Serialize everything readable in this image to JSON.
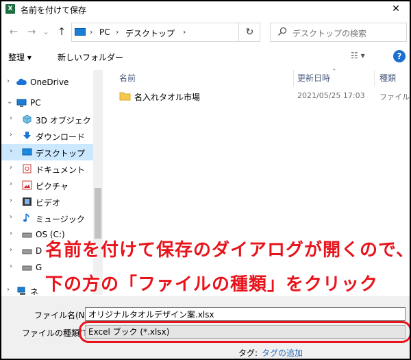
{
  "window": {
    "title": "名前を付けて保存",
    "app_icon_letter": "X",
    "close_glyph": "✕"
  },
  "nav": {
    "back_glyph": "←",
    "forward_glyph": "→",
    "recent_glyph": "⌄",
    "up_glyph": "↑",
    "address_sep": "›",
    "breadcrumbs": [
      "PC",
      "デスクトップ"
    ],
    "address_dropdown_glyph": "⌄",
    "refresh_glyph": "↻",
    "search_placeholder": "デスクトップの検索"
  },
  "toolbar": {
    "organize_label": "整理 ▾",
    "new_folder_label": "新しいフォルダー",
    "view_label": "☷ ▾",
    "help_label": "?"
  },
  "navpane": {
    "items": [
      {
        "label": "OneDrive",
        "icon": "cloud-icon",
        "chevron": "›"
      },
      {
        "label": "PC",
        "icon": "pc-icon",
        "chevron": "⌄"
      },
      {
        "label": "3D オブジェクト",
        "icon": "cube-icon",
        "chevron": "›"
      },
      {
        "label": "ダウンロード",
        "icon": "download-icon",
        "chevron": "›"
      },
      {
        "label": "デスクトップ",
        "icon": "desktop-icon",
        "chevron": "›"
      },
      {
        "label": "ドキュメント",
        "icon": "document-icon",
        "chevron": "›"
      },
      {
        "label": "ピクチャ",
        "icon": "picture-icon",
        "chevron": "›"
      },
      {
        "label": "ビデオ",
        "icon": "video-icon",
        "chevron": "›"
      },
      {
        "label": "ミュージック",
        "icon": "music-icon",
        "chevron": "›"
      },
      {
        "label": "OS (C:)",
        "icon": "drive-icon",
        "chevron": "›"
      },
      {
        "label": "D",
        "icon": "drive-icon",
        "chevron": "›"
      },
      {
        "label": "G",
        "icon": "drive-icon",
        "chevron": "›"
      },
      {
        "label": "ネ",
        "icon": "network-icon",
        "chevron": "›"
      }
    ]
  },
  "filelist": {
    "columns": [
      "名前",
      "更新日時",
      "種類"
    ],
    "sort_glyph": "⌃",
    "rows": [
      {
        "name": "名入れタオル市場",
        "date": "2021/05/25 17:03",
        "type": "ファイル フ"
      }
    ]
  },
  "annotation": {
    "line1": "名前を付けて保存のダイアログが開くので、",
    "line2": "下の方の「ファイルの種類」をクリック",
    "color": "#e8141b"
  },
  "form": {
    "filename_label": "ファイル名(N):",
    "filename_value": "オリジナルタオルデザイン案.xlsx",
    "filetype_label": "ファイルの種類(T):",
    "filetype_value": "Excel ブック (*.xlsx)",
    "tags_label": "タグ:",
    "tags_add": "タグの追加"
  }
}
